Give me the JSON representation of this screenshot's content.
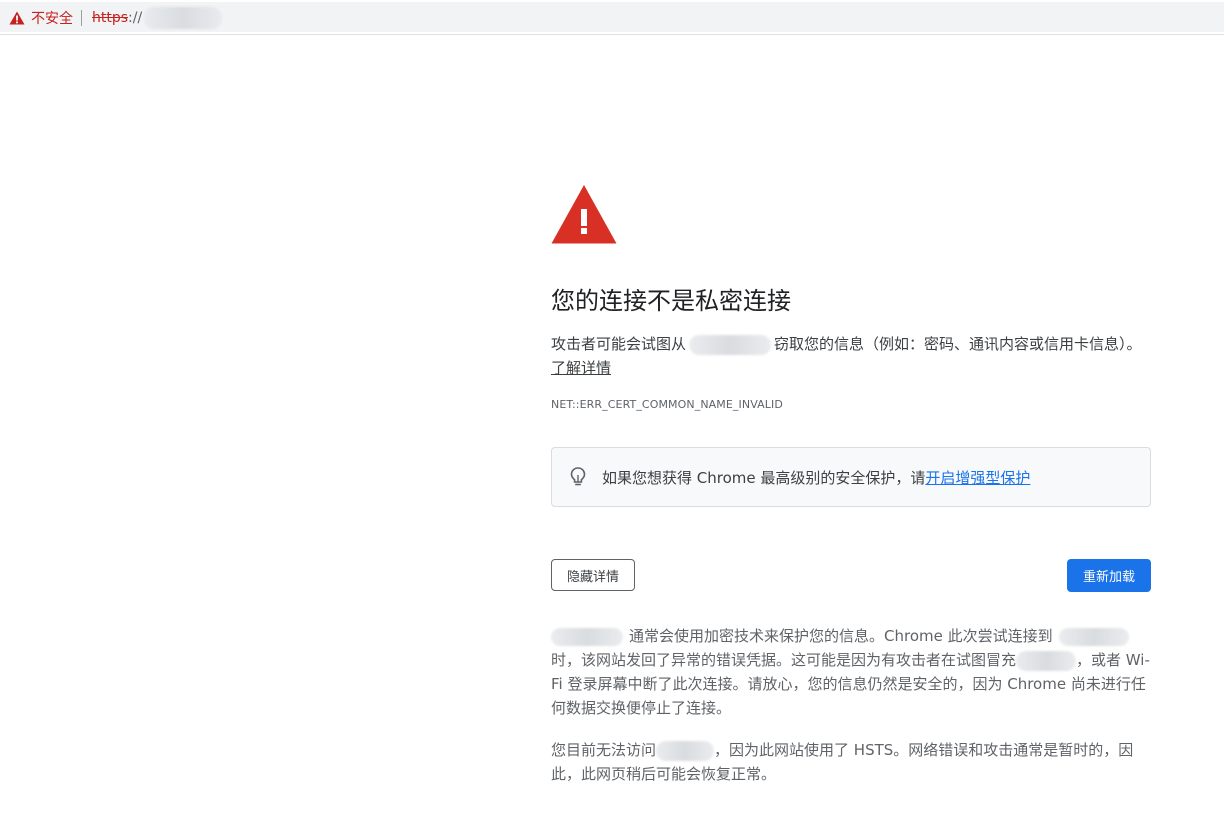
{
  "address_bar": {
    "not_secure_label": "不安全",
    "scheme": "https",
    "scheme_rest": "://"
  },
  "interstitial": {
    "heading": "您的连接不是私密连接",
    "desc_before": "攻击者可能会试图从",
    "desc_after": "窃取您的信息（例如：密码、通讯内容或信用卡信息）。",
    "learn_more": "了解详情",
    "error_code": "NET::ERR_CERT_COMMON_NAME_INVALID",
    "enhanced_text": "如果您想获得 Chrome 最高级别的安全保护，请",
    "enhanced_link": "开启增强型保护",
    "hide_details_button": "隐藏详情",
    "reload_button": "重新加载",
    "details_p1_a": "通常会使用加密技术来保护您的信息。Chrome 此次尝试连接到",
    "details_p1_b": "时，该网站发回了异常的错误凭据。这可能是因为有攻击者在试图冒充",
    "details_p1_c": "，或者 Wi-Fi 登录屏幕中断了此次连接。请放心，您的信息仍然是安全的，因为 Chrome 尚未进行任何数据交换便停止了连接。",
    "details_p2_a": "您目前无法访问",
    "details_p2_b": "，因为此网站使用了 HSTS。网络错误和攻击通常是暂时的，因此，此网页稍后可能会恢复正常。"
  },
  "colors": {
    "warning_red": "#d93025",
    "link_blue": "#1a73e8",
    "not_secure_red": "#c5221f"
  },
  "icons": {
    "address_warning": "warning-triangle-icon",
    "main_warning": "warning-triangle-icon",
    "enhanced_protection": "lightbulb-icon"
  }
}
